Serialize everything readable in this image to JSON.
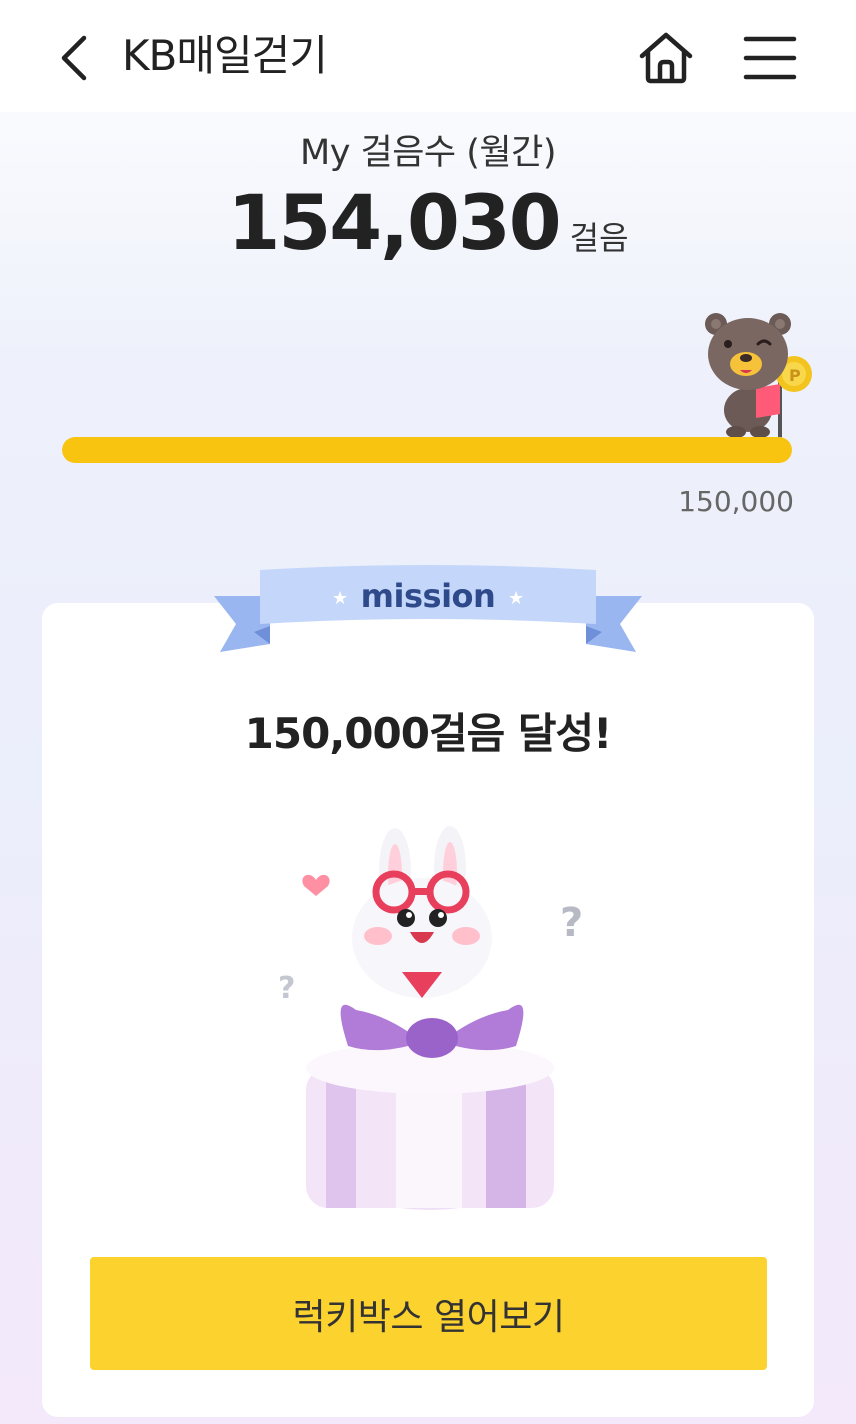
{
  "header": {
    "title": "KB매일걷기",
    "back_icon": "chevron-left-icon",
    "home_icon": "home-icon",
    "menu_icon": "hamburger-menu-icon"
  },
  "steps": {
    "label": "My 걸음수 (월간)",
    "value": "154,030",
    "unit": "걸음"
  },
  "progress": {
    "fraction": 1.0,
    "goal_label": "150,000",
    "fill_color": "#f8c40f"
  },
  "mission": {
    "ribbon_label": "mission",
    "title": "150,000걸음 달성!",
    "button_label": "럭키박스 열어보기",
    "button_color": "#fcd22f"
  }
}
